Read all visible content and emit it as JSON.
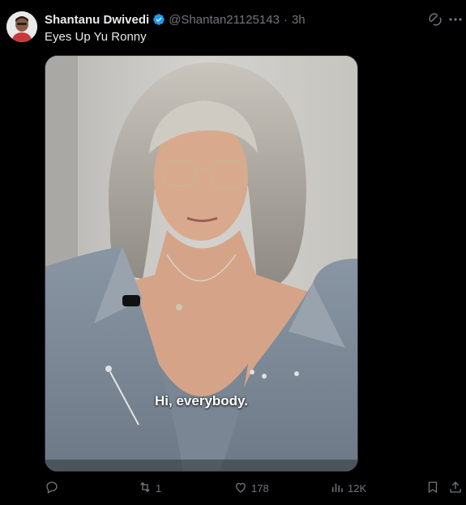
{
  "post": {
    "author_name": "Shantanu Dwivedi",
    "handle": "@Shantan21125143",
    "separator": "·",
    "time": "3h",
    "text": "Eyes Up Yu Ronny",
    "media_caption": "Hi, everybody."
  },
  "actions": {
    "replies": "",
    "reposts": "1",
    "likes": "178",
    "views": "12K"
  },
  "icons": {
    "verified": "verified-badge-icon",
    "grok": "grok-icon",
    "more": "more-icon",
    "reply": "reply-icon",
    "repost": "repost-icon",
    "like": "heart-icon",
    "views": "views-icon",
    "bookmark": "bookmark-icon",
    "share": "share-icon"
  },
  "colors": {
    "background": "#000000",
    "text": "#e7e9ea",
    "muted": "#71767b",
    "verified": "#1d9bf0"
  }
}
